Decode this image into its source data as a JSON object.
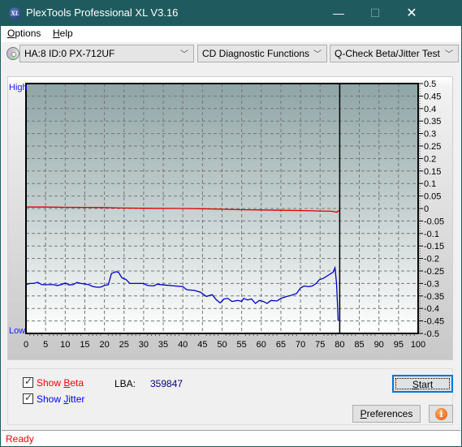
{
  "window": {
    "title": "PlexTools Professional XL V3.16",
    "icon": "xl-logo-icon",
    "controls": {
      "minimize": "—",
      "maximize": "☐",
      "close": "✕"
    }
  },
  "menu": [
    {
      "label": "Options",
      "accel": "O"
    },
    {
      "label": "Help",
      "accel": "H"
    }
  ],
  "toolbar": {
    "drive_icon": "disc-icon",
    "drive": "HA:8 ID:0  PX-712UF",
    "function": "CD Diagnostic Functions",
    "test": "Q-Check Beta/Jitter Test"
  },
  "chart": {
    "high_label": "High",
    "low_label": "Low"
  },
  "chart_data": {
    "type": "line",
    "title": "",
    "xlabel": "",
    "ylabel": "",
    "xlim": [
      0,
      100
    ],
    "ylim": [
      -0.5,
      0.5
    ],
    "x_ticks": [
      0,
      5,
      10,
      15,
      20,
      25,
      30,
      35,
      40,
      45,
      50,
      55,
      60,
      65,
      70,
      75,
      80,
      85,
      90,
      95,
      100
    ],
    "y_ticks": [
      0.5,
      0.45,
      0.4,
      0.35,
      0.3,
      0.25,
      0.2,
      0.15,
      0.1,
      0.05,
      0,
      -0.05,
      -0.1,
      -0.15,
      -0.2,
      -0.25,
      -0.3,
      -0.35,
      -0.4,
      -0.45,
      -0.5
    ],
    "y_tick_labels": [
      "0.5",
      "0.45",
      "0.4",
      "0.35",
      "0.3",
      "0.25",
      "0.2",
      "0.15",
      "0.1",
      "0.05",
      "0",
      "-0.05",
      "-0.1",
      "-0.15",
      "-0.2",
      "-0.25",
      "-0.3",
      "-0.35",
      "-0.4",
      "-0.45",
      "-0.5"
    ],
    "grid": true,
    "end_marker_x": 80,
    "series": [
      {
        "name": "Beta",
        "color": "#e00000",
        "x": [
          0,
          5,
          10,
          20,
          24,
          30,
          40,
          45,
          50,
          55,
          60,
          65,
          70,
          75,
          78,
          79.3,
          79.5,
          80
        ],
        "y": [
          0.006,
          0.006,
          0.005,
          0.004,
          0.002,
          0.001,
          0.0,
          -0.001,
          -0.003,
          -0.005,
          -0.006,
          -0.007,
          -0.008,
          -0.01,
          -0.011,
          -0.015,
          -0.01,
          -0.01
        ]
      },
      {
        "name": "Jitter",
        "color": "#0000c8",
        "x": [
          0,
          1,
          2,
          3,
          4,
          5,
          7,
          8,
          9,
          10,
          11,
          12,
          13,
          14,
          15,
          16,
          17,
          18,
          19,
          20,
          21,
          21.8,
          23,
          23.6,
          24.5,
          25.5,
          26.5,
          27.5,
          30,
          31,
          32.5,
          33.5,
          35,
          38,
          40,
          41,
          43,
          44.5,
          46,
          47.5,
          48.5,
          49.5,
          50.5,
          51.5,
          52.5,
          54,
          55,
          55.5,
          56.5,
          57.5,
          58.5,
          59.5,
          60.5,
          61.5,
          62.5,
          64,
          65,
          66.5,
          67.5,
          69,
          70,
          71,
          72,
          73,
          74,
          74.8,
          75.8,
          77,
          78.3,
          78.8,
          79.2,
          79.6
        ],
        "y": [
          -0.305,
          -0.3,
          -0.3,
          -0.295,
          -0.305,
          -0.305,
          -0.305,
          -0.308,
          -0.305,
          -0.298,
          -0.306,
          -0.305,
          -0.296,
          -0.3,
          -0.302,
          -0.305,
          -0.312,
          -0.315,
          -0.315,
          -0.308,
          -0.305,
          -0.26,
          -0.253,
          -0.256,
          -0.278,
          -0.284,
          -0.3,
          -0.3,
          -0.3,
          -0.308,
          -0.31,
          -0.303,
          -0.306,
          -0.31,
          -0.313,
          -0.325,
          -0.328,
          -0.335,
          -0.352,
          -0.345,
          -0.365,
          -0.378,
          -0.362,
          -0.36,
          -0.372,
          -0.368,
          -0.372,
          -0.36,
          -0.366,
          -0.362,
          -0.38,
          -0.368,
          -0.372,
          -0.38,
          -0.368,
          -0.37,
          -0.36,
          -0.352,
          -0.348,
          -0.34,
          -0.318,
          -0.31,
          -0.313,
          -0.31,
          -0.3,
          -0.285,
          -0.28,
          -0.268,
          -0.255,
          -0.237,
          -0.3,
          -0.45
        ]
      }
    ]
  },
  "controls": {
    "show_beta": {
      "label_pre": "Show ",
      "accel": "B",
      "label_post": "eta",
      "checked": true,
      "color": "#ff0000"
    },
    "show_jitter": {
      "label_pre": "Show ",
      "accel": "J",
      "label_post": "itter",
      "checked": true,
      "color": "#0000ff"
    },
    "lba_label": "LBA:",
    "lba_value": "359847",
    "start": {
      "accel": "S",
      "rest": "tart"
    },
    "preferences": {
      "accel": "P",
      "rest": "references"
    },
    "info_icon": "info-icon"
  },
  "status": {
    "text": "Ready"
  }
}
